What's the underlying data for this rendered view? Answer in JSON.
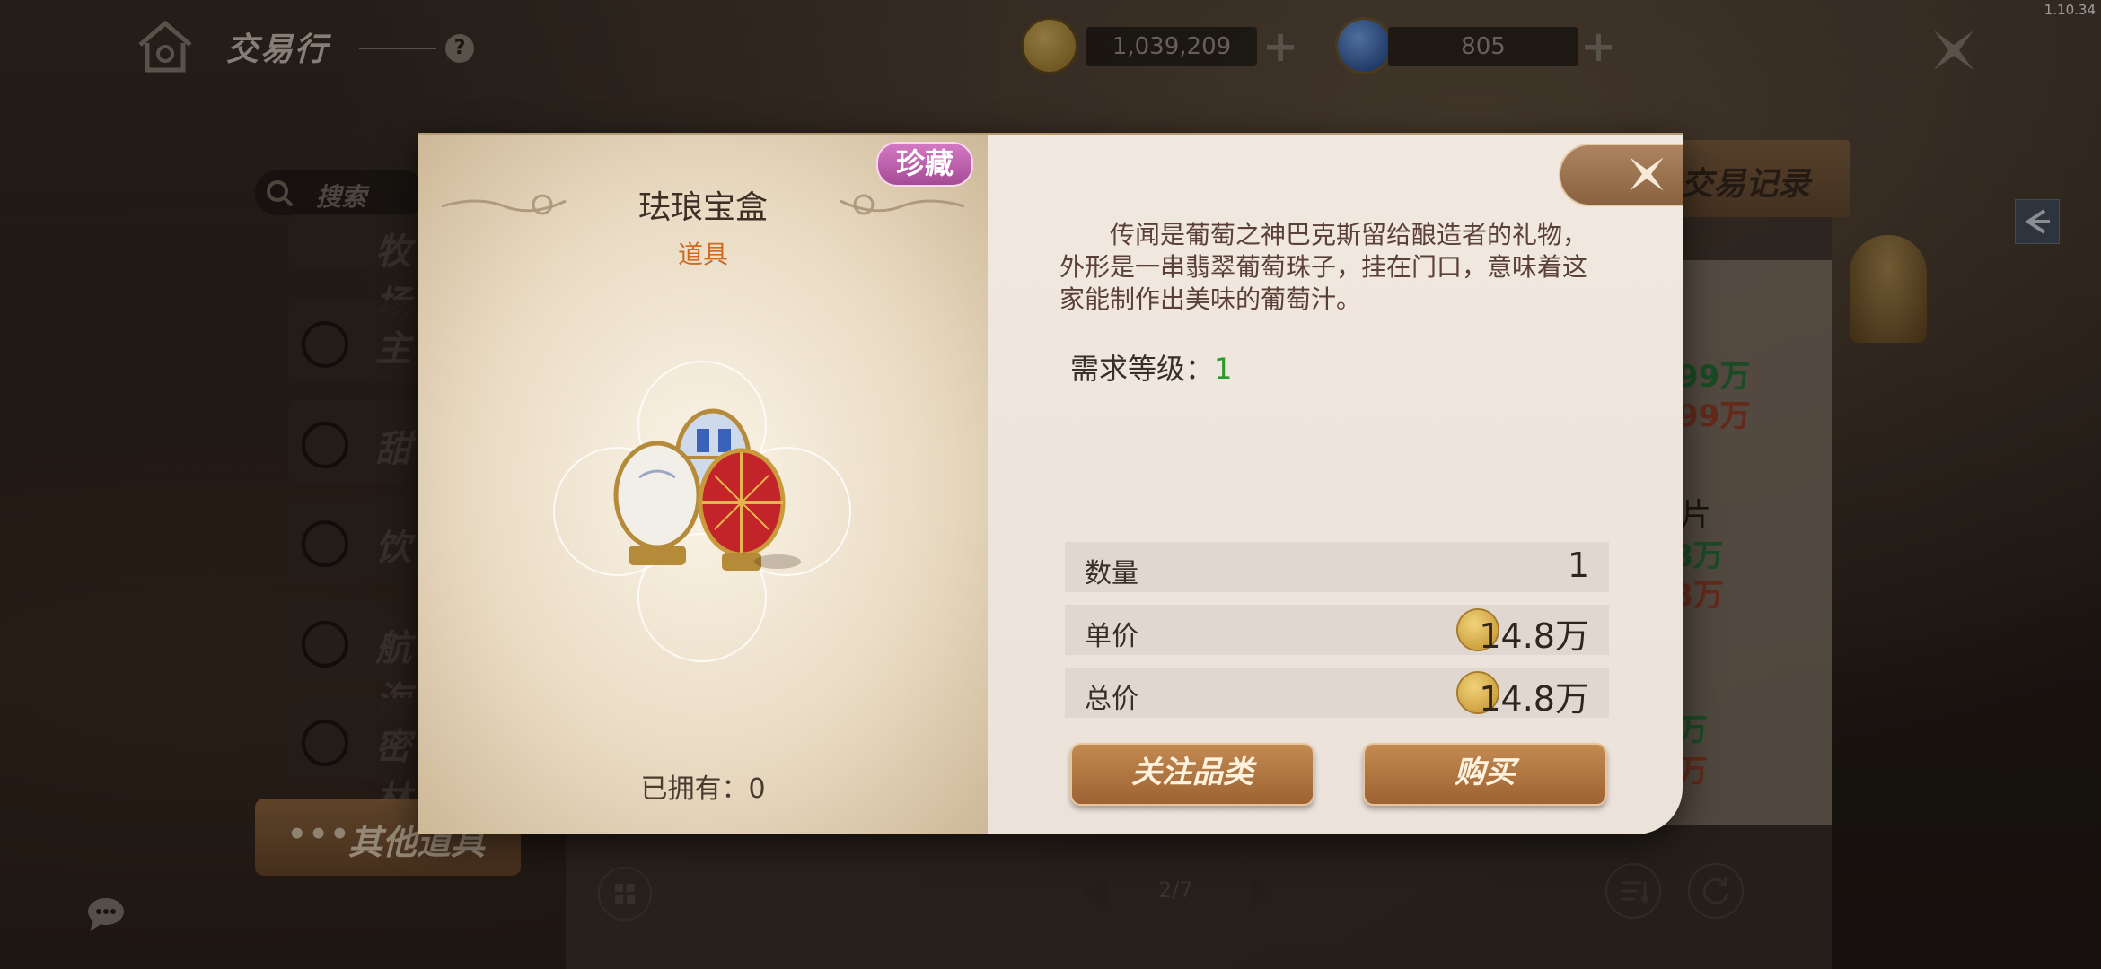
{
  "version": "1.10.34",
  "header": {
    "title": "交易行",
    "help_icon": "question-icon",
    "gold": "1,039,209",
    "gems": "805"
  },
  "search": {
    "placeholder": "搜索"
  },
  "menu": {
    "items": [
      {
        "label": "牧场",
        "icon": "rooster-icon"
      },
      {
        "label": "主",
        "icon": "pot-icon"
      },
      {
        "label": "甜",
        "icon": "bowl-icon"
      },
      {
        "label": "饮",
        "icon": "drink-icon"
      },
      {
        "label": "航海",
        "icon": "anchor-icon"
      },
      {
        "label": "密林",
        "icon": "bow-icon"
      }
    ],
    "active": {
      "label": "其他道具",
      "icon": "dots-icon"
    }
  },
  "background": {
    "record_tab": "交易记录",
    "listing_snippets": [
      "99万",
      "99万",
      "片",
      "8万",
      "8万",
      "万",
      "万"
    ],
    "pager": "2/7"
  },
  "dialog": {
    "badge": "珍藏",
    "item_name": "珐琅宝盒",
    "item_type": "道具",
    "owned_label": "已拥有：",
    "owned_value": "0",
    "description": "传闻是葡萄之神巴克斯留给酿造者的礼物，外形是一串翡翠葡萄珠子，挂在门口，意味着这家能制作出美味的葡萄汁。",
    "requirement_label": "需求等级：",
    "requirement_value": "1",
    "quantity_label": "数量",
    "quantity_value": "1",
    "unit_price_label": "单价",
    "unit_price_value": "14.8万",
    "total_price_label": "总价",
    "total_price_value": "14.8万",
    "follow_button": "关注品类",
    "buy_button": "购买"
  },
  "colors": {
    "accent_brown": "#9c6232",
    "rare_badge": "#c060b0",
    "item_type": "#d06a22",
    "requirement_value": "#2e9a2e"
  }
}
